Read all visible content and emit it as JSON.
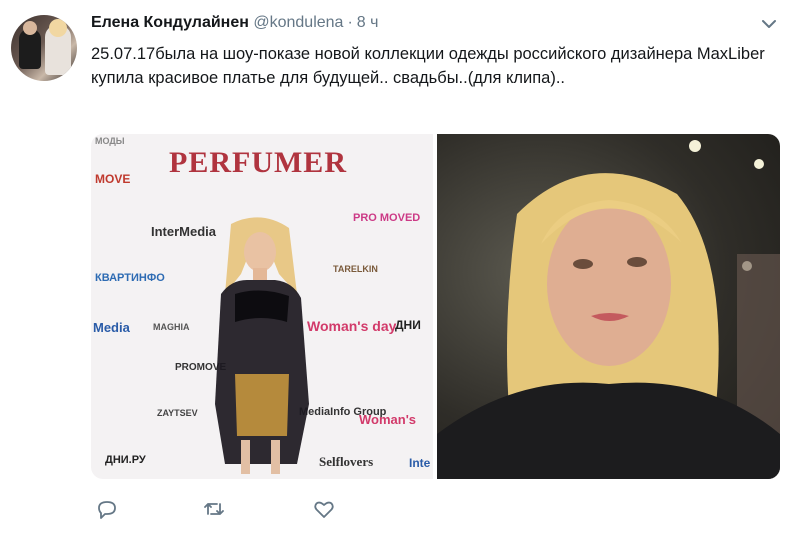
{
  "tweet": {
    "author_name": "Елена Кондулайнен",
    "handle": "@kondulena",
    "separator": "·",
    "time": "8 ч",
    "text": "25.07.17была на шоу-показе новой коллекции одежды российского дизайнера MaxLiber купила красивое платье для будущей.. свадьбы..(для клипа).."
  },
  "photo1": {
    "logos": [
      "МОДЫ",
      "PERFUMER",
      "MOVE",
      "InterMedia",
      "PRO MOVED",
      "КВАРТИНФО",
      "TARELKIN",
      "Media",
      "MAGHIA",
      "Woman's day",
      "ДНИ",
      "PROMOVE",
      "ZAYTSEV",
      "MediaInfo Group",
      "Woman's",
      "ДНИ.РУ",
      "Selflovers",
      "Inte"
    ]
  },
  "colors": {
    "text": "#14171a",
    "secondary": "#657786",
    "icon": "#657786"
  },
  "icons": [
    "caret-down-icon",
    "reply-icon",
    "retweet-icon",
    "like-icon"
  ]
}
